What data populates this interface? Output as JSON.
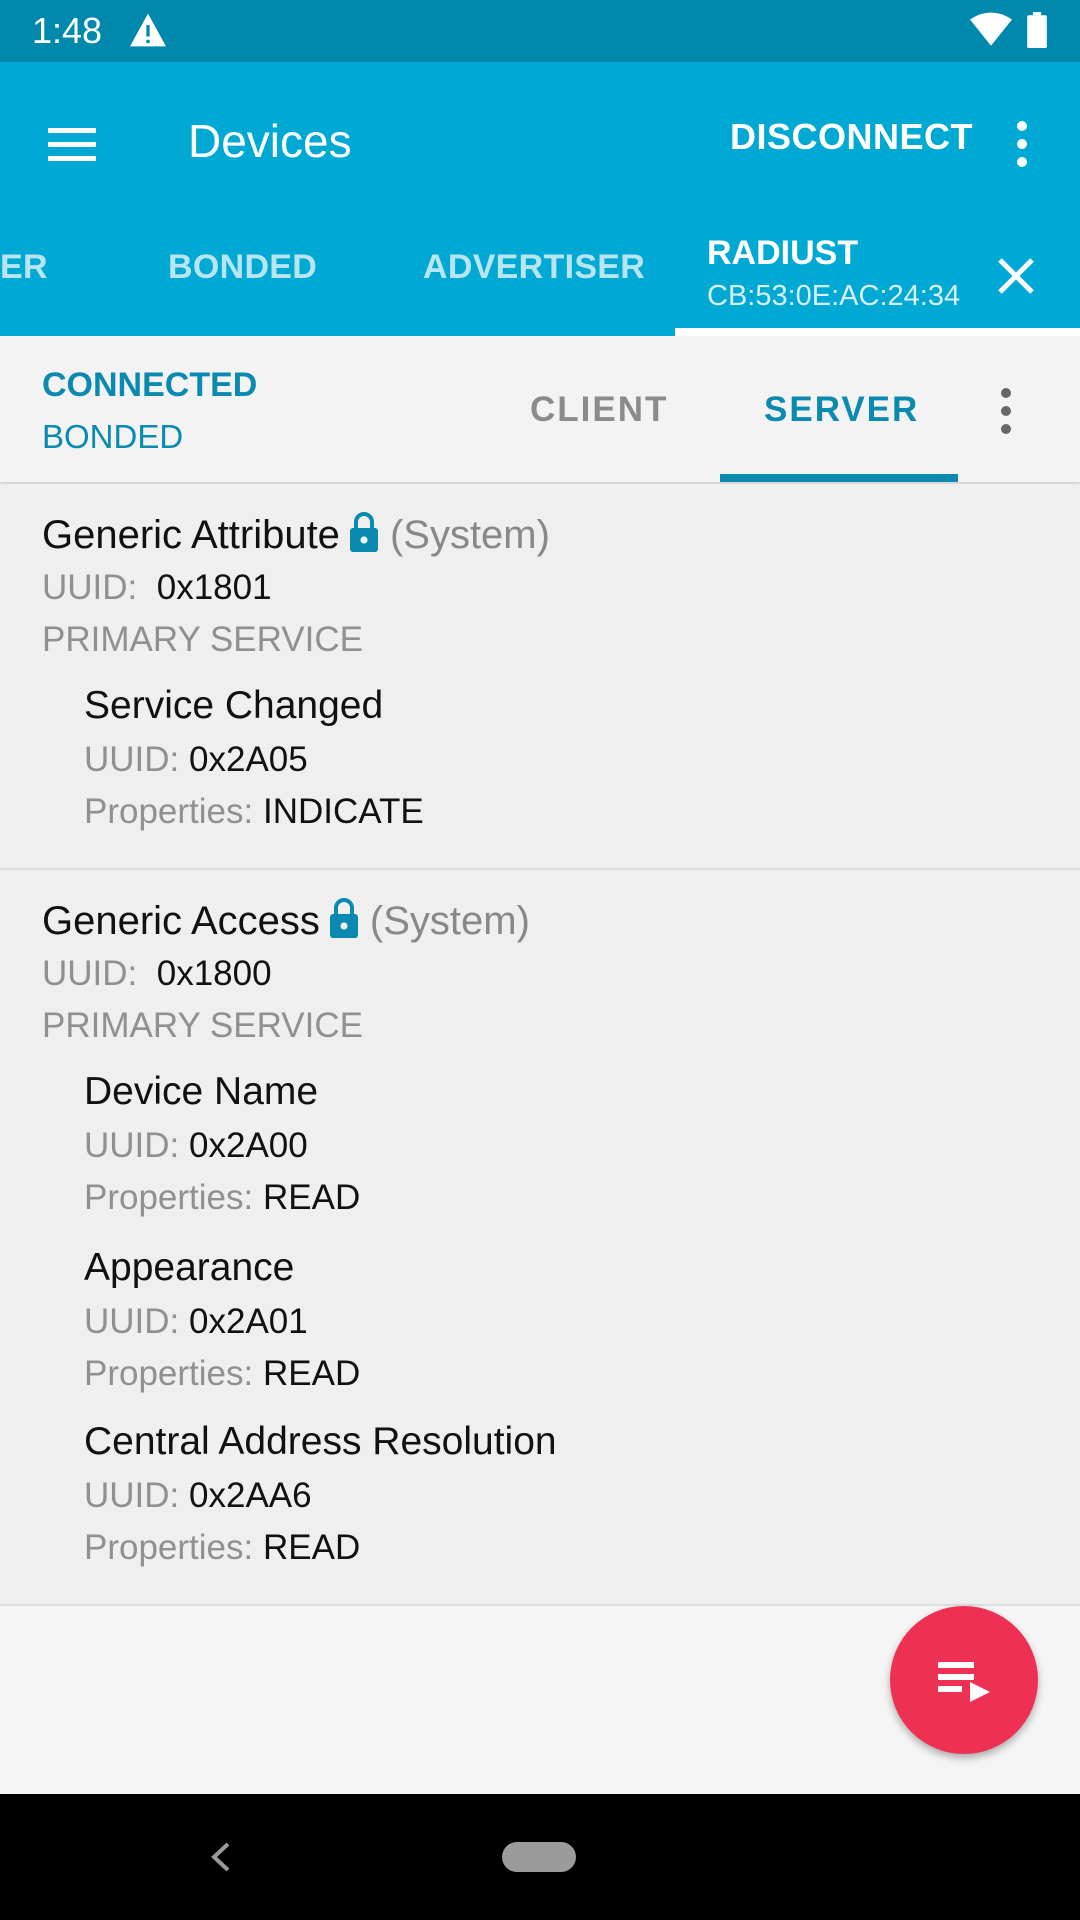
{
  "status_bar": {
    "time": "1:48",
    "warning_icon": "warning-icon",
    "wifi_icon": "wifi-icon",
    "battery_icon": "battery-icon"
  },
  "app_bar": {
    "title": "Devices",
    "disconnect_label": "DISCONNECT",
    "tabs": [
      "ER",
      "BONDED",
      "ADVERTISER"
    ],
    "active_tab": {
      "name": "RADIUST",
      "address": "CB:53:0E:AC:24:34"
    }
  },
  "sub_bar": {
    "connection_state": "CONNECTED",
    "bond_state": "BONDED",
    "tabs": [
      "CLIENT",
      "SERVER"
    ],
    "selected_tab": "SERVER"
  },
  "labels": {
    "uuid": "UUID:",
    "properties": "Properties:",
    "system": "(System)"
  },
  "services": [
    {
      "name": "Generic Attribute",
      "uuid": "0x1801",
      "type": "PRIMARY SERVICE",
      "characteristics": [
        {
          "name": "Service Changed",
          "uuid": "0x2A05",
          "properties": "INDICATE"
        }
      ]
    },
    {
      "name": "Generic Access",
      "uuid": "0x1800",
      "type": "PRIMARY SERVICE",
      "characteristics": [
        {
          "name": "Device Name",
          "uuid": "0x2A00",
          "properties": "READ"
        },
        {
          "name": "Appearance",
          "uuid": "0x2A01",
          "properties": "READ"
        },
        {
          "name": "Central Address Resolution",
          "uuid": "0x2AA6",
          "properties": "READ"
        }
      ]
    }
  ],
  "colors": {
    "status_bar": "#0088ad",
    "app_bar": "#00a9d3",
    "accent": "#0a8ab1",
    "fab": "#ee3153"
  }
}
